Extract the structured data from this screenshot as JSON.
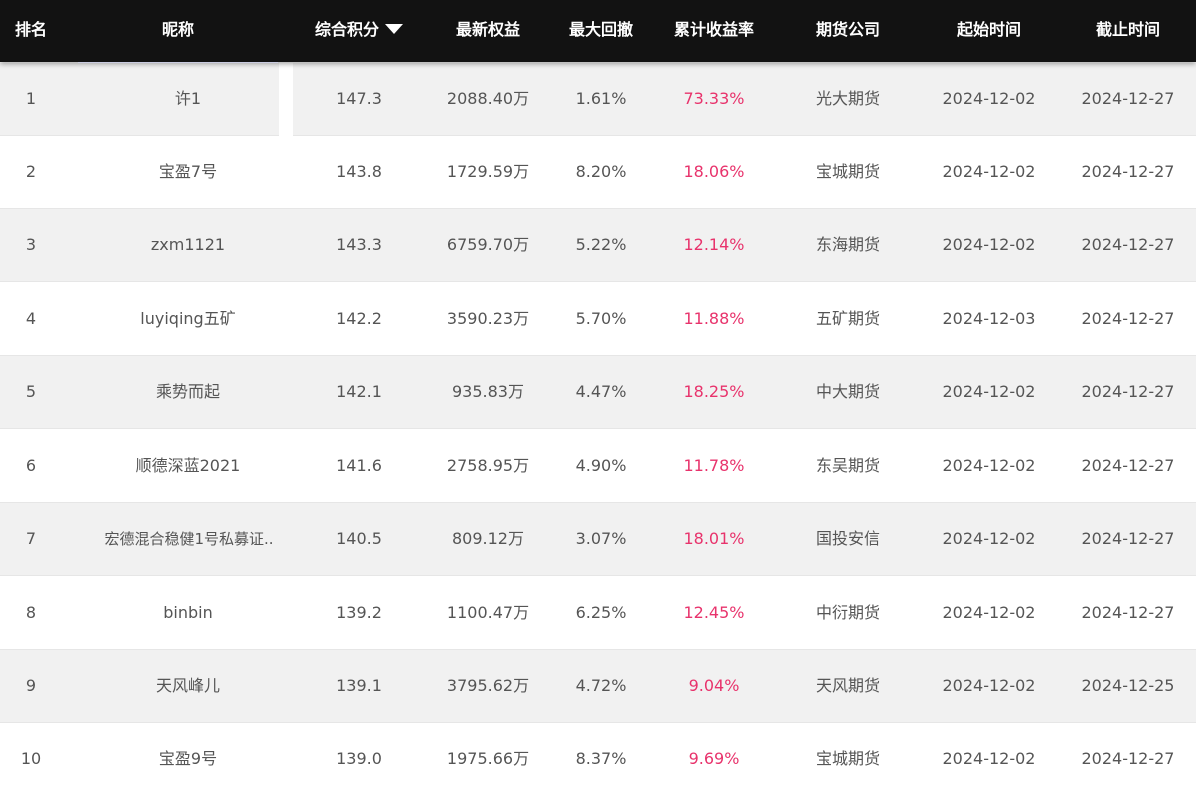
{
  "header": {
    "rank": "排名",
    "nickname": "昵称",
    "score": "综合积分",
    "equity": "最新权益",
    "drawdown": "最大回撤",
    "return": "累计收益率",
    "broker": "期货公司",
    "start": "起始时间",
    "end": "截止时间",
    "sort_icon": "caret-down-icon"
  },
  "colors": {
    "header_bg": "#121212",
    "header_text": "#ffffff",
    "row_alt_bg": "#f1f1f1",
    "row_bg": "#ffffff",
    "text": "#555555",
    "return_text": "#e8336c"
  },
  "rows": [
    {
      "rank": "1",
      "nickname": "许1",
      "score": "147.3",
      "equity": "2088.40万",
      "drawdown": "1.61%",
      "return": "73.33%",
      "broker": "光大期货",
      "start": "2024-12-02",
      "end": "2024-12-27"
    },
    {
      "rank": "2",
      "nickname": "宝盈7号",
      "score": "143.8",
      "equity": "1729.59万",
      "drawdown": "8.20%",
      "return": "18.06%",
      "broker": "宝城期货",
      "start": "2024-12-02",
      "end": "2024-12-27"
    },
    {
      "rank": "3",
      "nickname": "zxm1121",
      "score": "143.3",
      "equity": "6759.70万",
      "drawdown": "5.22%",
      "return": "12.14%",
      "broker": "东海期货",
      "start": "2024-12-02",
      "end": "2024-12-27"
    },
    {
      "rank": "4",
      "nickname": "luyiqing五矿",
      "score": "142.2",
      "equity": "3590.23万",
      "drawdown": "5.70%",
      "return": "11.88%",
      "broker": "五矿期货",
      "start": "2024-12-03",
      "end": "2024-12-27"
    },
    {
      "rank": "5",
      "nickname": "乘势而起",
      "score": "142.1",
      "equity": "935.83万",
      "drawdown": "4.47%",
      "return": "18.25%",
      "broker": "中大期货",
      "start": "2024-12-02",
      "end": "2024-12-27"
    },
    {
      "rank": "6",
      "nickname": "顺德深蓝2021",
      "score": "141.6",
      "equity": "2758.95万",
      "drawdown": "4.90%",
      "return": "11.78%",
      "broker": "东吴期货",
      "start": "2024-12-02",
      "end": "2024-12-27"
    },
    {
      "rank": "7",
      "nickname": "宏德混合稳健1号私募证..",
      "score": "140.5",
      "equity": "809.12万",
      "drawdown": "3.07%",
      "return": "18.01%",
      "broker": "国投安信",
      "start": "2024-12-02",
      "end": "2024-12-27"
    },
    {
      "rank": "8",
      "nickname": "binbin",
      "score": "139.2",
      "equity": "1100.47万",
      "drawdown": "6.25%",
      "return": "12.45%",
      "broker": "中衍期货",
      "start": "2024-12-02",
      "end": "2024-12-27"
    },
    {
      "rank": "9",
      "nickname": "天风峰儿",
      "score": "139.1",
      "equity": "3795.62万",
      "drawdown": "4.72%",
      "return": "9.04%",
      "broker": "天风期货",
      "start": "2024-12-02",
      "end": "2024-12-25"
    },
    {
      "rank": "10",
      "nickname": "宝盈9号",
      "score": "139.0",
      "equity": "1975.66万",
      "drawdown": "8.37%",
      "return": "9.69%",
      "broker": "宝城期货",
      "start": "2024-12-02",
      "end": "2024-12-27"
    }
  ]
}
